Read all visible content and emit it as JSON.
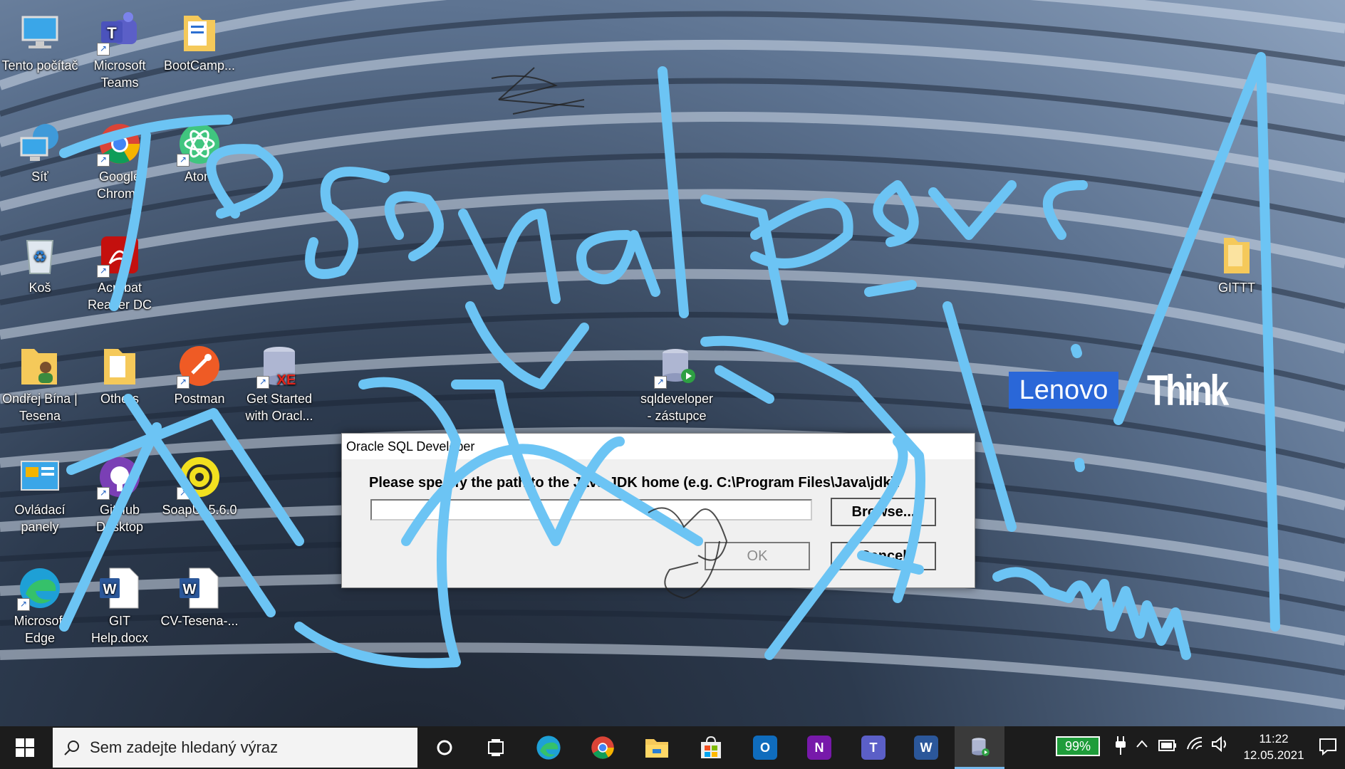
{
  "desktop": {
    "icons": [
      {
        "key": "tento",
        "label": "Tento počítač"
      },
      {
        "key": "teams",
        "label": "Microsoft Teams"
      },
      {
        "key": "bootcamp",
        "label": "BootCamp..."
      },
      {
        "key": "sit",
        "label": "Síť"
      },
      {
        "key": "chrome",
        "label": "Google Chrome"
      },
      {
        "key": "atom",
        "label": "Atom"
      },
      {
        "key": "kos",
        "label": "Koš"
      },
      {
        "key": "acrobat",
        "label": "Acrobat Reader DC"
      },
      {
        "key": "ondrej",
        "label": "Ondřej Bína | Tesena"
      },
      {
        "key": "others",
        "label": "Others"
      },
      {
        "key": "postman",
        "label": "Postman"
      },
      {
        "key": "oraclexe",
        "label": "Get Started with Oracl..."
      },
      {
        "key": "sqldev",
        "label": "sqldeveloper - zástupce"
      },
      {
        "key": "ovladaci",
        "label": "Ovládací panely"
      },
      {
        "key": "github",
        "label": "GitHub Desktop"
      },
      {
        "key": "soapui",
        "label": "SoapUI 5.6.0"
      },
      {
        "key": "edge",
        "label": "Microsoft Edge"
      },
      {
        "key": "githelp",
        "label": "GIT Help.docx"
      },
      {
        "key": "cv",
        "label": "CV-Tesena-..."
      },
      {
        "key": "gittt",
        "label": "GITTT"
      }
    ],
    "brand": {
      "lenovo": "Lenovo",
      "think": "Think"
    }
  },
  "dialog": {
    "title": "Oracle SQL Developer",
    "prompt": "Please specify the path to the Java JDK home (e.g. C:\\Program Files\\Java\\jdk):",
    "path_value": "",
    "browse_label": "Browse...",
    "ok_label": "OK",
    "cancel_label": "Cancel"
  },
  "taskbar": {
    "search_placeholder": "Sem zadejte hledaný výraz",
    "apps": [
      "Microsoft Edge",
      "Google Chrome",
      "File Explorer",
      "Microsoft Store",
      "Outlook",
      "OneNote",
      "Microsoft Teams",
      "Word",
      "SQL Developer"
    ],
    "battery": "99%",
    "time": "11:22",
    "date": "12.05.2021"
  },
  "colors": {
    "ink": "#6cc4f4",
    "taskbar": "#1c1c1c",
    "lenovo_blue": "#2a67d8",
    "battery_green": "#1e9c3a"
  }
}
